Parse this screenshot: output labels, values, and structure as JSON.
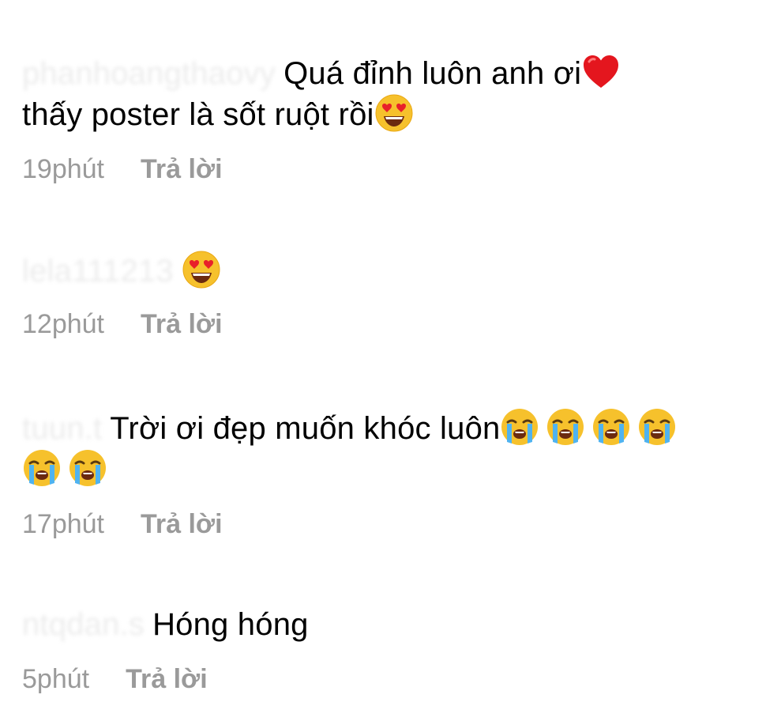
{
  "comments": [
    {
      "username": "phanhoangthaovy",
      "text": "Quá đỉnh luôn anh ơi",
      "text2": "thấy poster là sốt ruột rồi",
      "emojis": [
        "red-heart",
        "heart-eyes-face"
      ],
      "time": "19phút",
      "reply_label": "Trả lời"
    },
    {
      "username": "lela111213",
      "text": "",
      "emojis": [
        "heart-eyes-face"
      ],
      "time": "12phút",
      "reply_label": "Trả lời"
    },
    {
      "username": "tuun.t",
      "text": "Trời ơi đẹp muốn khóc luôn",
      "emojis": [
        "loudly-crying-face",
        "loudly-crying-face",
        "loudly-crying-face",
        "loudly-crying-face",
        "loudly-crying-face",
        "loudly-crying-face"
      ],
      "time": "17phút",
      "reply_label": "Trả lời"
    },
    {
      "username": "ntqdan.s",
      "text": "Hóng hóng",
      "emojis": [],
      "time": "5phút",
      "reply_label": "Trả lời"
    }
  ],
  "colors": {
    "meta_text": "#9a9a9a",
    "body_text": "#000000",
    "background": "#ffffff"
  }
}
